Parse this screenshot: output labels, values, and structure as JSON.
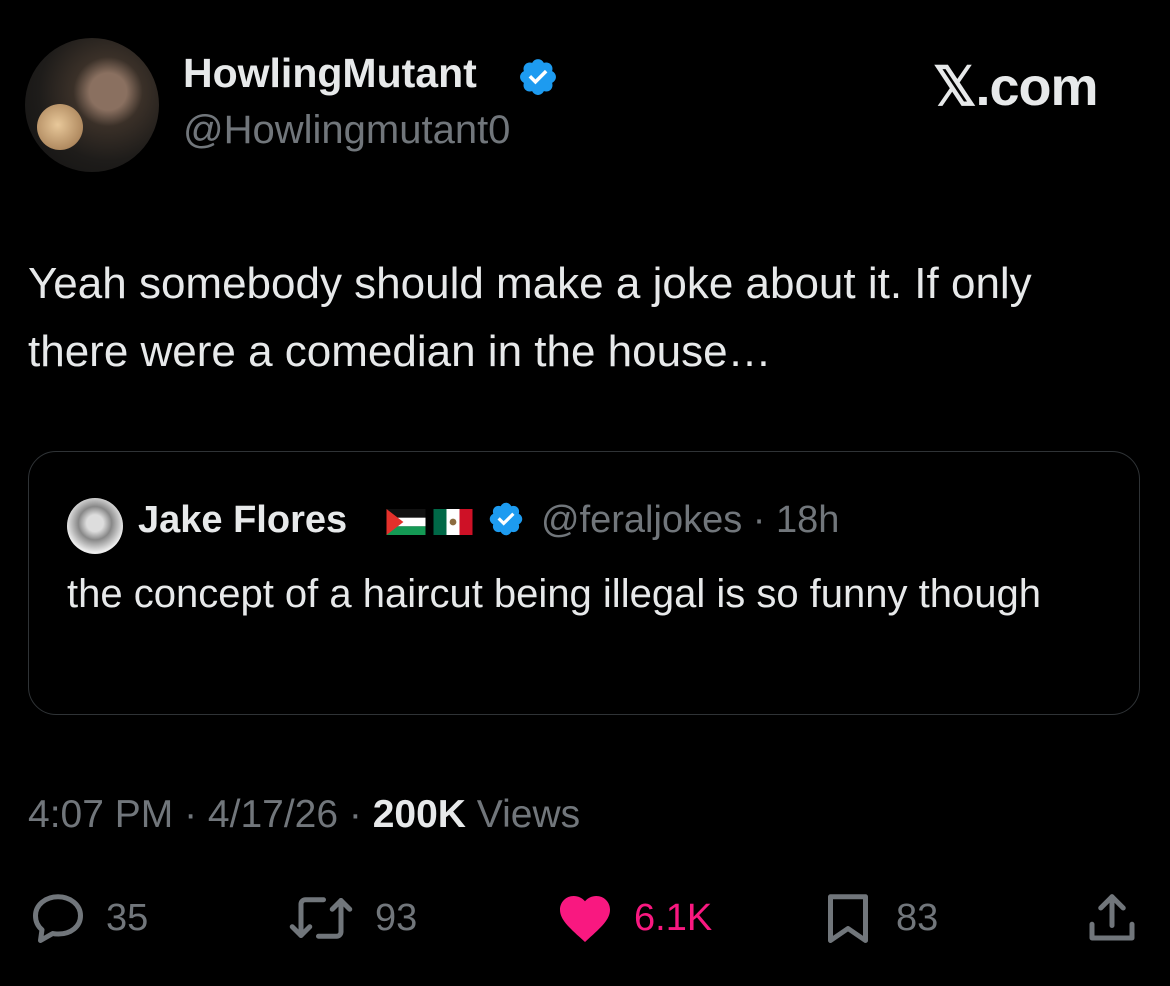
{
  "author": {
    "display_name": "HowlingMutant",
    "handle": "@Howlingmutant0",
    "verified": true
  },
  "brand": "𝕏.com",
  "tweet": {
    "text": "Yeah somebody should make a joke about it.  If only there were a comedian in the house…"
  },
  "quoted": {
    "display_name": "Jake Flores",
    "flags": [
      "palestine-flag",
      "mexico-flag"
    ],
    "verified": true,
    "handle": "@feraljokes",
    "age": "18h",
    "text": "the concept of a haircut being illegal is so funny though"
  },
  "meta": {
    "time": "4:07 PM",
    "date": "4/17/26",
    "views_count": "200K",
    "views_label": "Views"
  },
  "actions": {
    "replies": "35",
    "reposts": "93",
    "likes": "6.1K",
    "bookmarks": "83"
  },
  "colors": {
    "background": "#000000",
    "text_primary": "#e7e9ea",
    "text_secondary": "#71767b",
    "verified_blue": "#1d9bf0",
    "like_pink": "#f91880",
    "border": "#2f3336"
  }
}
